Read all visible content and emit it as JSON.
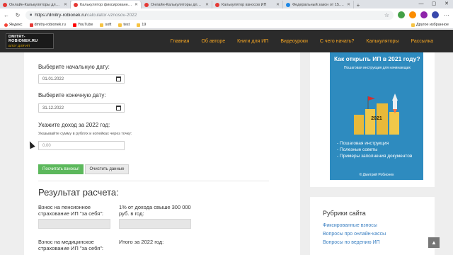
{
  "browser": {
    "tabs": [
      {
        "title": "Онлайн-Калькуляторы для ИП",
        "active": false
      },
      {
        "title": "Калькулятор фиксированных вз",
        "active": true
      },
      {
        "title": "Онлайн-Калькуляторы для ИП",
        "active": false
      },
      {
        "title": "Калькулятор взносов ИП",
        "active": false
      },
      {
        "title": "Федеральный закон от 15.10.2",
        "active": false
      }
    ],
    "url_host": "https://dmitry-robionek.ru",
    "url_path": "/calculator-vznosov-2022",
    "bookmarks": [
      "Яндекс",
      "dmitry-robionek.ru",
      "YouTube",
      "soft",
      "test",
      "19"
    ],
    "other_bookmarks": "Другое избранное"
  },
  "site": {
    "logo_line1": "DMITRY-ROBIONEK.RU",
    "logo_line2": "БЛОГ ДЛЯ ИП",
    "menu": [
      "Главная",
      "Об авторе",
      "Книги для ИП",
      "Видеоуроки",
      "С чего начать?",
      "Калькуляторы",
      "Рассылка"
    ]
  },
  "form": {
    "start_label": "Выберите начальную дату:",
    "start_value": "01.01.2022",
    "end_label": "Выберите конечную дату:",
    "end_value": "31.12.2022",
    "income_label": "Укажите доход за 2022 год:",
    "income_hint": "Указывайте сумму в рублях и копейках через точку:",
    "income_placeholder": "0.00",
    "calc_button": "Посчитать взносы!",
    "clear_button": "Очистить данные"
  },
  "result": {
    "title": "Результат расчета:",
    "pension_label": "Взнос на пенсионное страхование ИП \"за себя\":",
    "one_percent_label": "1% от дохода свыше 300 000 руб. в год:",
    "medical_label": "Взнос на медицинское страхование ИП \"за себя\":",
    "total_label": "Итого за 2022 год:"
  },
  "banner": {
    "title": "Как открыть ИП в 2021 году?",
    "subtitle": "Пошаговая инструкция для начинающих",
    "year": "2021",
    "bullets": [
      "- Пошаговая инструкция",
      "- Полезные советы",
      "- Примеры заполнения документов"
    ],
    "author": "© Дмитрий Робионек"
  },
  "rubrics": {
    "title": "Рубрики сайта",
    "items": [
      "Фиксированные взносы",
      "Вопросы про онлайн-кассы",
      "Вопросы по ведению ИП"
    ]
  },
  "scroll_top_icon": "arrow-up-icon"
}
